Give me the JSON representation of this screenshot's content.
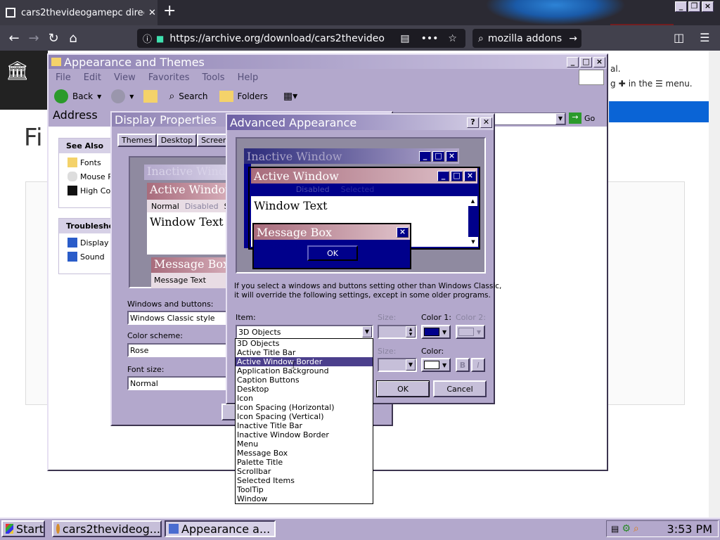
{
  "browser": {
    "tab_title": "cars2thevideogamepc direc",
    "tab_close": "✕",
    "new_tab": "+",
    "url": "https://archive.org/download/cars2thevideo",
    "search_text": "mozilla addons",
    "notification_line1": "al.",
    "notification_line2": "g",
    "notification_line2b": "in the ☰ menu.",
    "page_heading": "Fi"
  },
  "explorer": {
    "title": "Appearance and Themes",
    "menu": [
      "File",
      "Edit",
      "View",
      "Favorites",
      "Tools",
      "Help"
    ],
    "back_label": "Back",
    "search_label": "Search",
    "folders_label": "Folders",
    "address_label": "Address",
    "go_label": "Go",
    "see_also_title": "See Also",
    "see_also_items": [
      "Fonts",
      "Mouse P",
      "High Co"
    ],
    "troubleshoot_title": "Troublesho",
    "troubleshoot_items": [
      "Display",
      "Sound"
    ]
  },
  "display_props": {
    "title": "Display Properties",
    "tabs": [
      "Themes",
      "Desktop",
      "Screen S"
    ],
    "preview_inactive": "Inactive Windo",
    "preview_active": "Active Window",
    "preview_menu_normal": "Normal",
    "preview_menu_disabled": "Disabled",
    "preview_menu_s": "S",
    "preview_window_text": "Window Text",
    "preview_msgbox": "Message Box",
    "preview_msg_text": "Message Text",
    "windows_buttons_label": "Windows and buttons:",
    "windows_buttons_value": "Windows Classic style",
    "color_scheme_label": "Color scheme:",
    "color_scheme_value": "Rose",
    "font_size_label": "Font size:",
    "font_size_value": "Normal"
  },
  "advanced": {
    "title": "Advanced Appearance",
    "help_btn": "?",
    "close_btn": "✕",
    "inactive_title": "Inactive Window",
    "active_title": "Active Window",
    "menu_normal": "Normal",
    "menu_disabled": "Disabled",
    "menu_selected": "Selected",
    "window_text": "Window Text",
    "msgbox_title": "Message Box",
    "msgbox_text": "Message Text",
    "ok_preview": "OK",
    "info_text_1": "If you select a windows and buttons setting other than Windows Classic,",
    "info_text_2": "it will override the following settings, except in some older programs.",
    "item_label": "Item:",
    "item_value": "3D Objects",
    "size_label": "Size:",
    "color1_label": "Color 1:",
    "color2_label": "Color 2:",
    "font_size_label": "Size:",
    "font_color_label": "Color:",
    "bold_btn": "B",
    "italic_btn": "I",
    "ok_label": "OK",
    "cancel_label": "Cancel",
    "dropdown_items": [
      "3D Objects",
      "Active Title Bar",
      "Active Window Border",
      "Application Background",
      "Caption Buttons",
      "Desktop",
      "Icon",
      "Icon Spacing (Horizontal)",
      "Icon Spacing (Vertical)",
      "Inactive Title Bar",
      "Inactive Window Border",
      "Menu",
      "Message Box",
      "Palette Title",
      "Scrollbar",
      "Selected Items",
      "ToolTip",
      "Window"
    ],
    "selected_index": 2
  },
  "taskbar": {
    "start_label": "Start",
    "task1": "cars2thevideog...",
    "task2": "Appearance a...",
    "clock": "3:53 PM"
  },
  "colors": {
    "desktop": "#b3a8cc",
    "title_active": "#8f83b4",
    "color1_swatch": "#00008b",
    "selection": "#4b3f8c"
  }
}
